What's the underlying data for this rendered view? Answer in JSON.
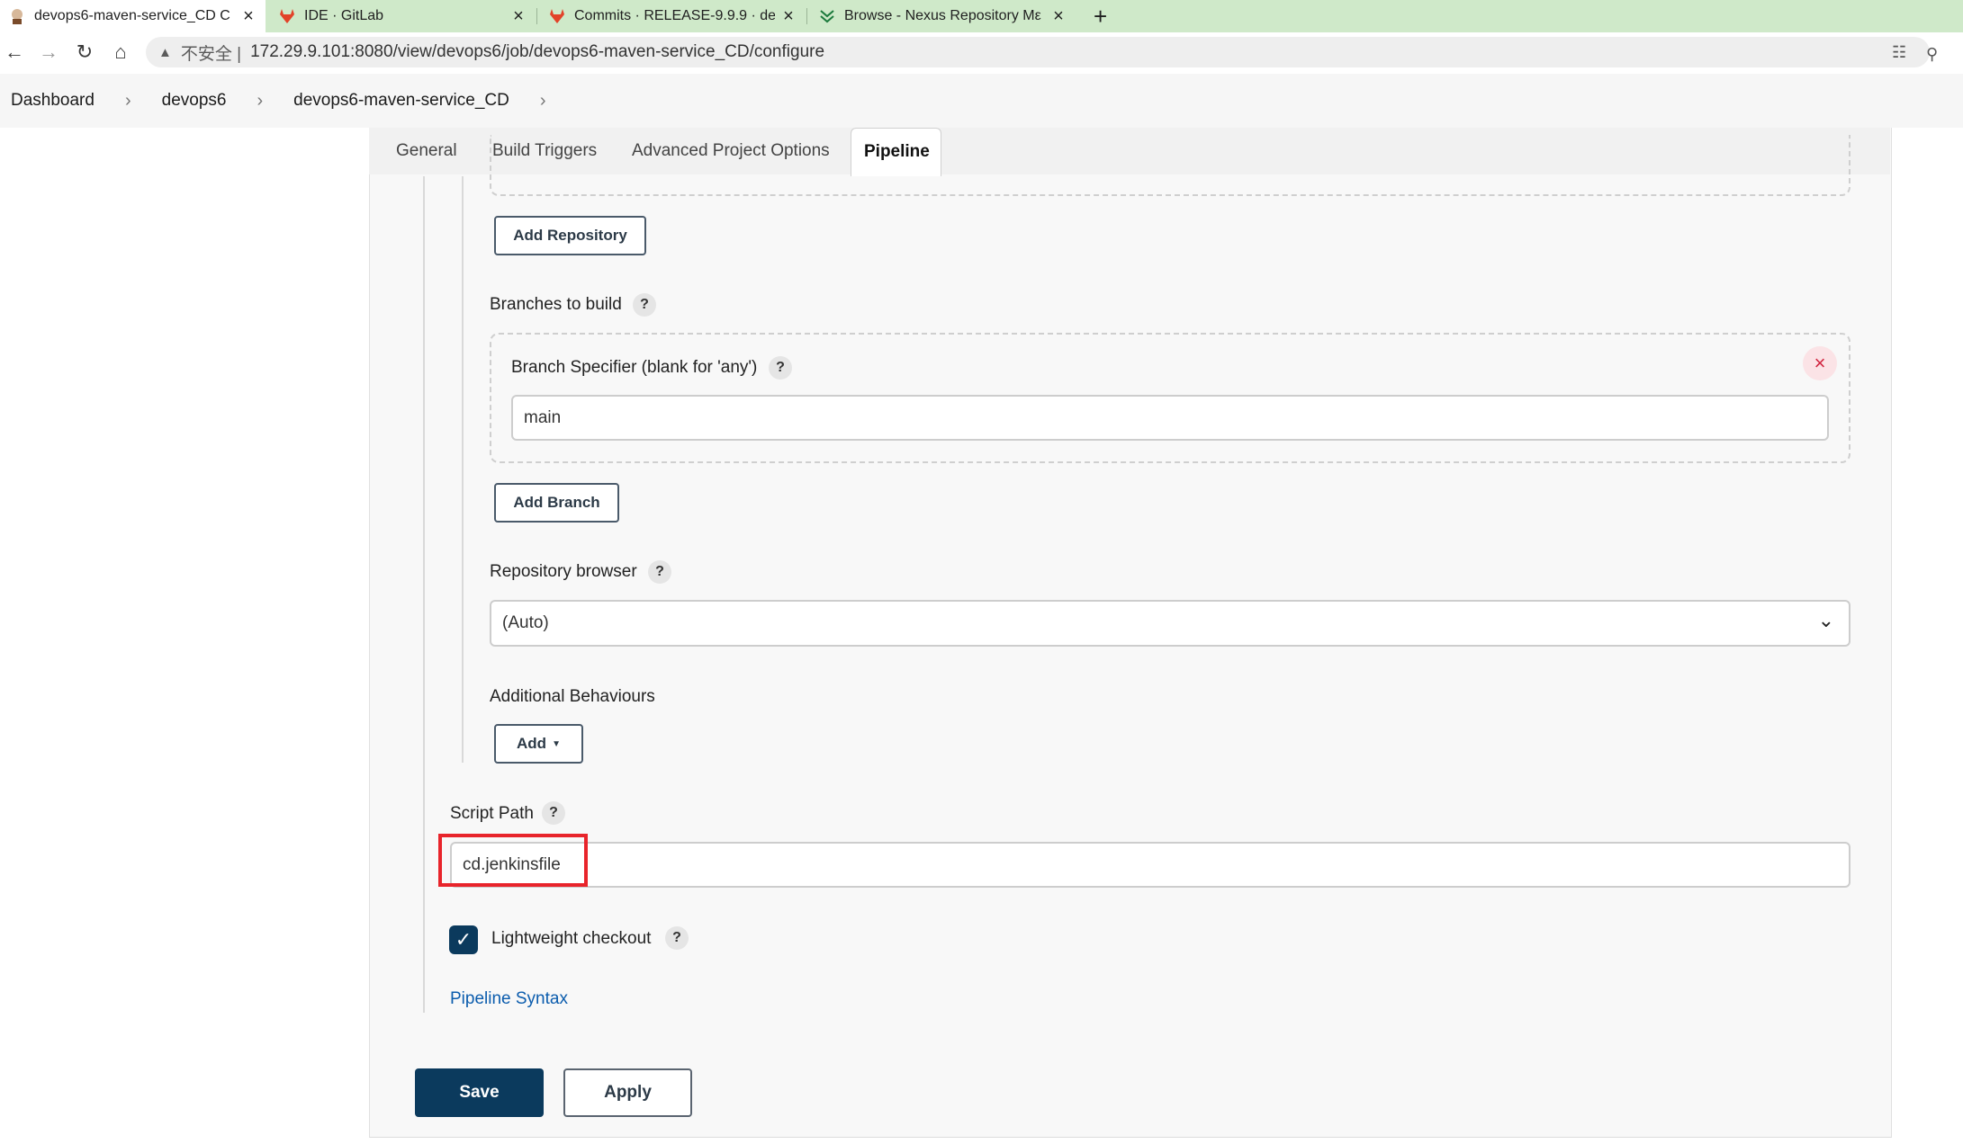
{
  "browser": {
    "tabs": [
      {
        "title": "devops6-maven-service_CD C",
        "icon": "jenkins-icon"
      },
      {
        "title": "IDE · GitLab",
        "icon": "gitlab-icon"
      },
      {
        "title": "Commits · RELEASE-9.9.9 · dev",
        "icon": "gitlab-icon"
      },
      {
        "title": "Browse - Nexus Repository Mε",
        "icon": "nexus-icon"
      }
    ],
    "new_tab": "+",
    "close_glyph": "×",
    "insecure_label": "不安全 |",
    "url": "172.29.9.101:8080/view/devops6/job/devops6-maven-service_CD/configure"
  },
  "breadcrumb": [
    "Dashboard",
    "devops6",
    "devops6-maven-service_CD"
  ],
  "config_tabs": [
    "General",
    "Build Triggers",
    "Advanced Project Options",
    "Pipeline"
  ],
  "form": {
    "add_repository": "Add Repository",
    "branches_label": "Branches to build",
    "branch_specifier_label": "Branch Specifier (blank for 'any')",
    "branch_value": "main",
    "add_branch": "Add Branch",
    "repo_browser_label": "Repository browser",
    "repo_browser_value": "(Auto)",
    "additional_behaviours_label": "Additional Behaviours",
    "add_button": "Add",
    "script_path_label": "Script Path",
    "script_path_value": "cd.jenkinsfile",
    "lightweight_label": "Lightweight checkout",
    "lightweight_checked": true,
    "pipeline_syntax": "Pipeline Syntax",
    "help_glyph": "?"
  },
  "actions": {
    "save": "Save",
    "apply": "Apply"
  },
  "colors": {
    "accent": "#0b3a5d",
    "highlight": "#e8242b",
    "tabstrip": "#cfe9c9"
  }
}
